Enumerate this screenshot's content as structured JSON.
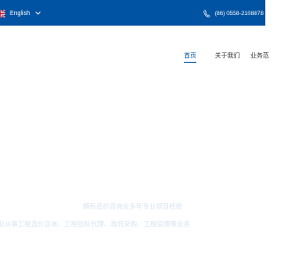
{
  "topbar": {
    "language": {
      "label": "English",
      "flag_icon": "uk-flag-icon",
      "dropdown_icon": "chevron-down-icon"
    },
    "phone": {
      "icon": "phone-icon",
      "number": "(86) 0558-2108878"
    },
    "background_color": "#0052a2"
  },
  "nav": {
    "items": [
      {
        "label": "首页",
        "active": true
      },
      {
        "label": "关于我们",
        "active": false
      },
      {
        "label": "业务范",
        "active": false
      }
    ],
    "active_color": "#0052a2"
  },
  "hero": {
    "line1": "拥有造价咨询业多年专业项目经验",
    "line2": "专业从事工程造价咨询、工程招标代理、政府采购、工程监理等业务"
  }
}
